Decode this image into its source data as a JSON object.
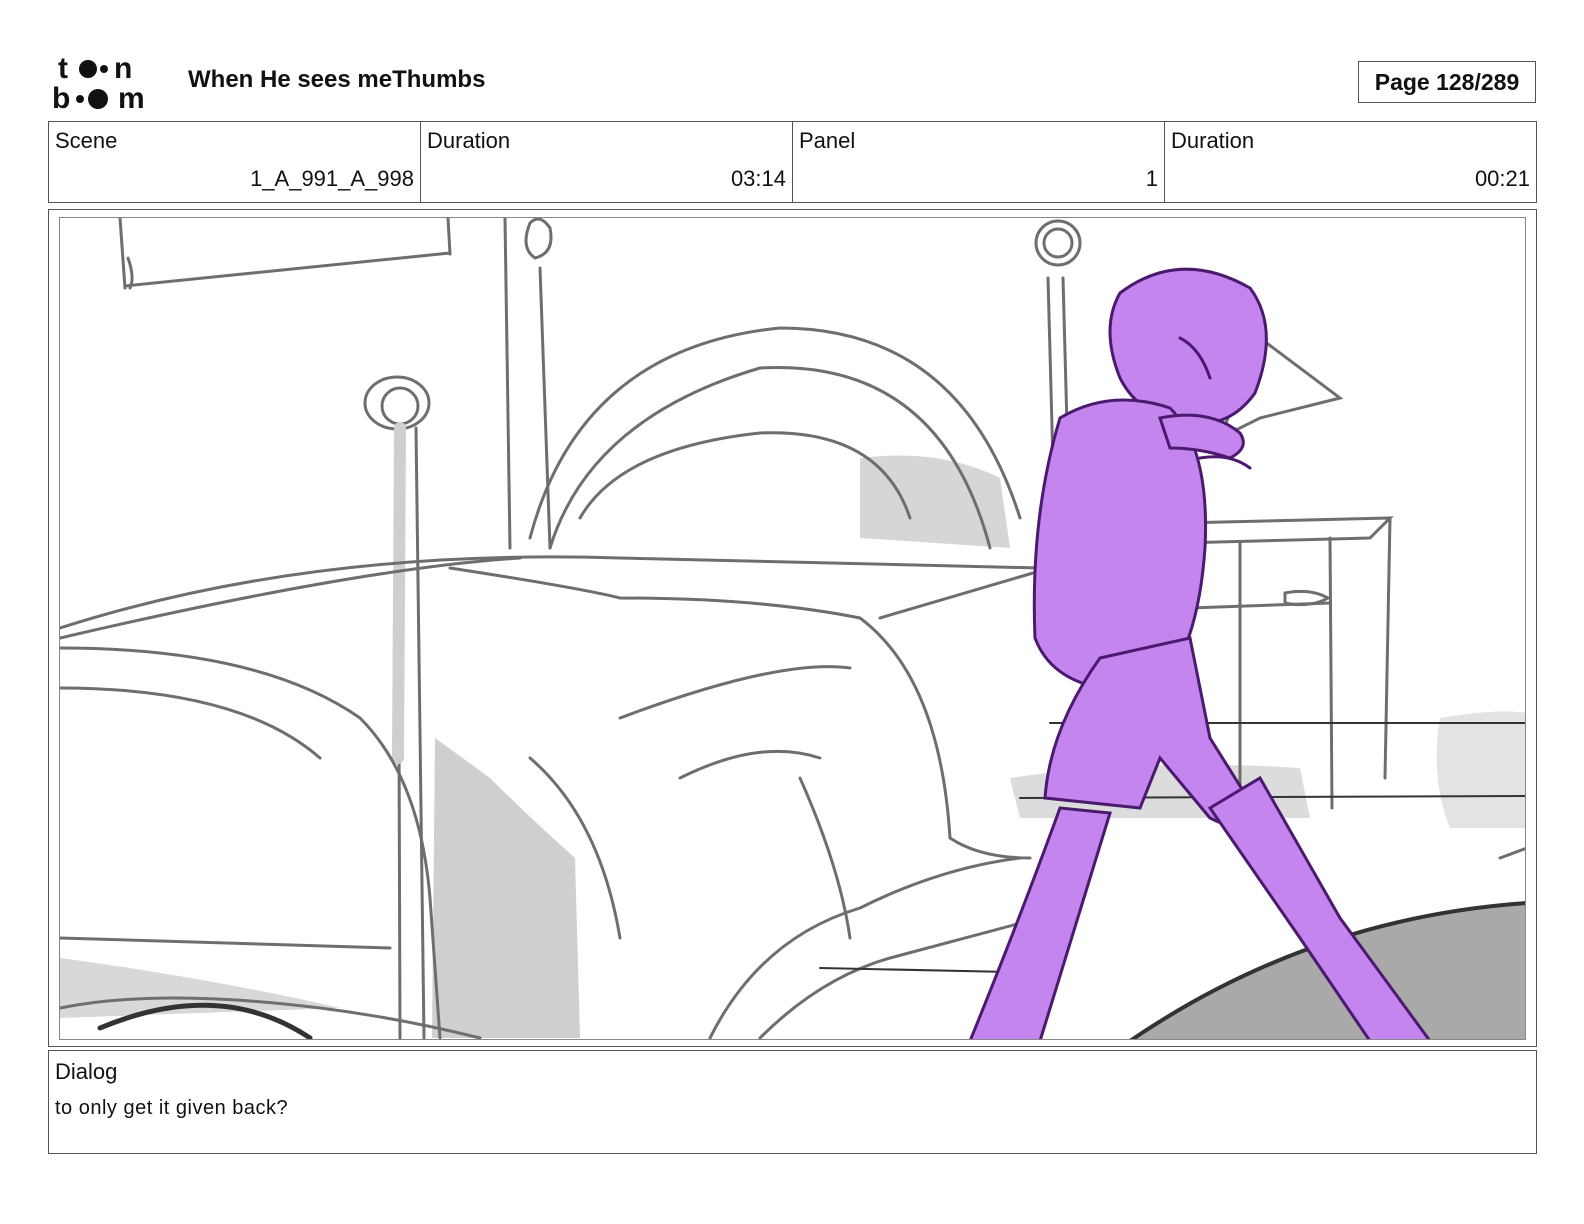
{
  "header": {
    "logo_text": "toonboom",
    "title": "When He sees meThumbs",
    "page_label": "Page 128/289"
  },
  "info": {
    "scene_label": "Scene",
    "scene_value": "1_A_991_A_998",
    "scene_duration_label": "Duration",
    "scene_duration_value": "03:14",
    "panel_label": "Panel",
    "panel_value": "1",
    "panel_duration_label": "Duration",
    "panel_duration_value": "00:21"
  },
  "dialog": {
    "label": "Dialog",
    "text": "to only get it given back?"
  },
  "colors": {
    "character_fill": "#c585ee",
    "character_line": "#4a1a6e",
    "sketch_line": "#6e6e6e",
    "shadow": "#cfcfcf",
    "rug": "#a9a9a9"
  }
}
